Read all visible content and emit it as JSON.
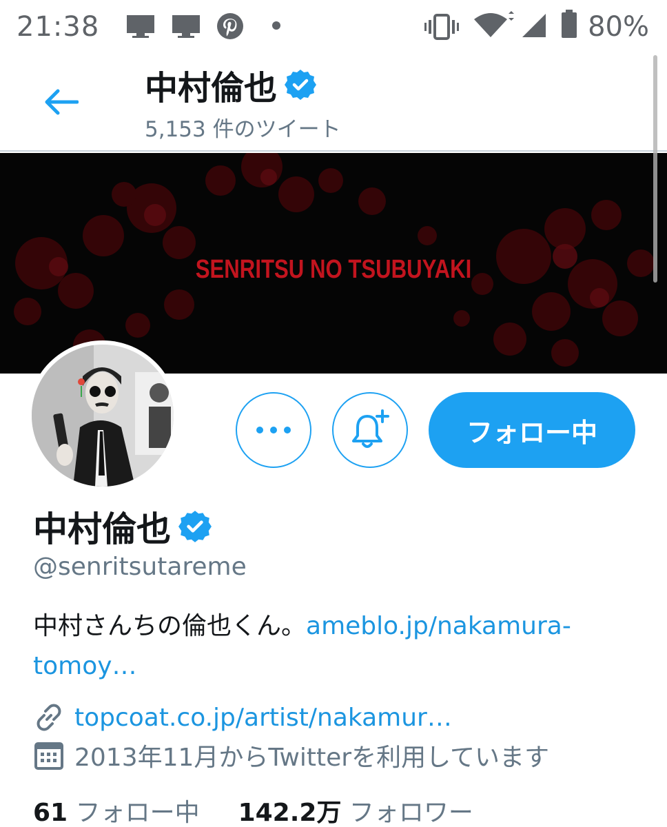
{
  "status_bar": {
    "time": "21:38",
    "battery_percent": "80%",
    "icons": [
      "monitor-icon",
      "monitor-icon",
      "pinterest-icon",
      "dot-icon",
      "vibrate-icon",
      "wifi-icon",
      "signal-icon",
      "battery-icon"
    ]
  },
  "header": {
    "name": "中村倫也",
    "tweet_count": "5,153 件のツイート",
    "verified": true
  },
  "banner": {
    "title": "SENRITSU NO TSUBUYAKI",
    "background_color": "#050505",
    "accent_color": "#c2141e"
  },
  "actions": {
    "follow_label": "フォロー中",
    "accent_color": "#1da1f2"
  },
  "profile": {
    "name": "中村倫也",
    "handle": "@senritsutareme",
    "bio_text": "中村さんちの倫也くん。",
    "bio_link_part1": "ameblo.jp/nakamura-",
    "bio_link_part2": "tomoy…",
    "website": "topcoat.co.jp/artist/nakamur…",
    "joined": "2013年11月からTwitterを利用しています",
    "following_count": "61",
    "following_label": "フォロー中",
    "followers_count": "142.2万",
    "followers_label": "フォロワー"
  }
}
